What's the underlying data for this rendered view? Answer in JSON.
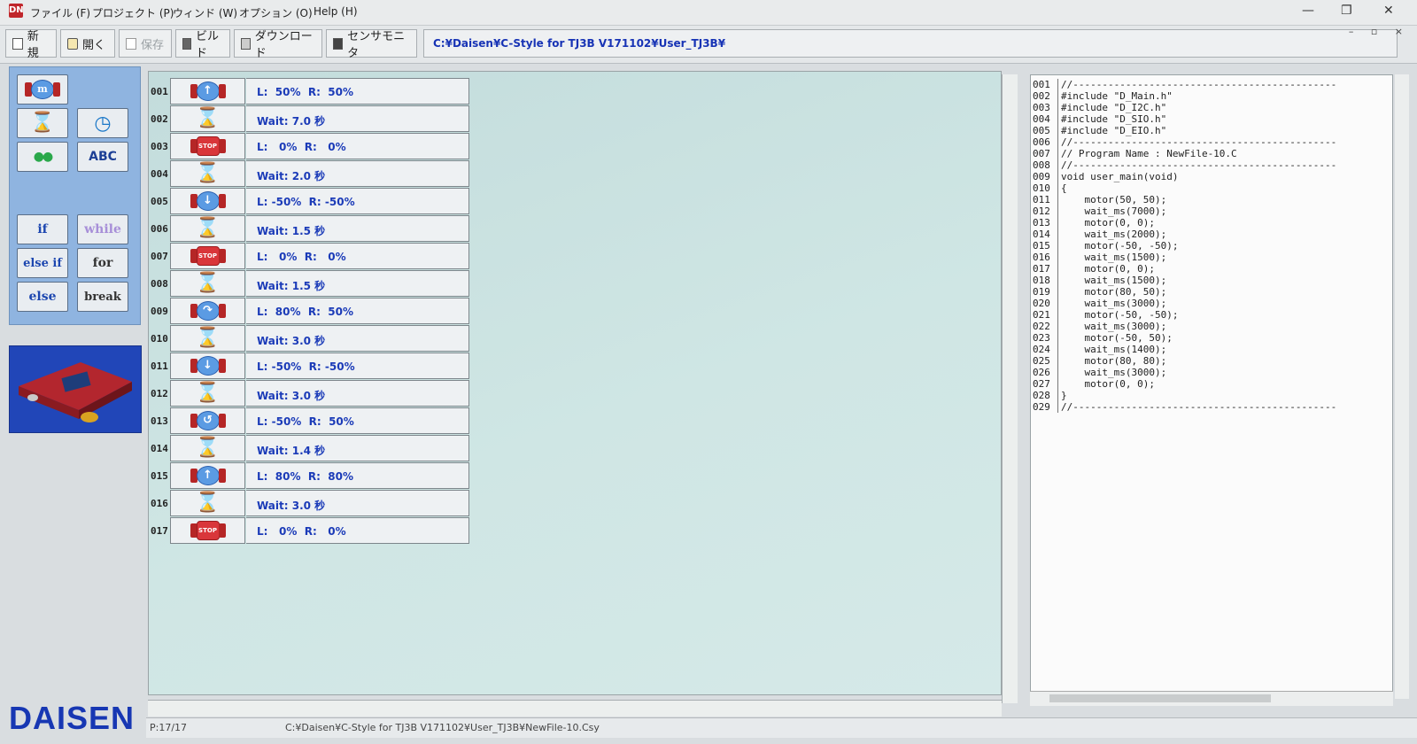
{
  "window": {
    "app_icon": "DN",
    "menus": [
      "ファイル (F)",
      "プロジェクト (P)",
      "ウィンド (W)",
      "オプション (O)",
      "Help (H)"
    ],
    "controls": [
      "—",
      "❐",
      "✕"
    ]
  },
  "toolbar": {
    "new_label": "新規",
    "open_label": "開く",
    "save_label": "保存",
    "build_label": "ビルド",
    "download_label": "ダウンロード",
    "sensor_label": "センサモニタ",
    "project_path": "C:¥Daisen¥C-Style for TJ3B V171102¥User_TJ3B¥"
  },
  "palette": {
    "motor_glyph": "m",
    "wait_glyph": "⌛",
    "timer_glyph": "◷",
    "led_glyph": "●●",
    "abc_label": "ABC",
    "if_label": "if",
    "while_label": "while",
    "elseif_label": "else if",
    "for_label": "for",
    "else_label": "else",
    "break_label": "break"
  },
  "brand": {
    "logo_text": "DAISEN"
  },
  "program": {
    "rows": [
      {
        "num": "001",
        "type": "motor",
        "dir": "↑",
        "text": "L:  50%  R:  50%"
      },
      {
        "num": "002",
        "type": "wait",
        "text": "Wait: 7.0 秒"
      },
      {
        "num": "003",
        "type": "stop",
        "text": "L:   0%  R:   0%"
      },
      {
        "num": "004",
        "type": "wait",
        "text": "Wait: 2.0 秒"
      },
      {
        "num": "005",
        "type": "motor",
        "dir": "↓",
        "text": "L: -50%  R: -50%"
      },
      {
        "num": "006",
        "type": "wait",
        "text": "Wait: 1.5 秒"
      },
      {
        "num": "007",
        "type": "stop",
        "text": "L:   0%  R:   0%"
      },
      {
        "num": "008",
        "type": "wait",
        "text": "Wait: 1.5 秒"
      },
      {
        "num": "009",
        "type": "motor",
        "dir": "↷",
        "text": "L:  80%  R:  50%"
      },
      {
        "num": "010",
        "type": "wait",
        "text": "Wait: 3.0 秒"
      },
      {
        "num": "011",
        "type": "motor",
        "dir": "↓",
        "text": "L: -50%  R: -50%"
      },
      {
        "num": "012",
        "type": "wait",
        "text": "Wait: 3.0 秒"
      },
      {
        "num": "013",
        "type": "motor",
        "dir": "↺",
        "text": "L: -50%  R:  50%"
      },
      {
        "num": "014",
        "type": "wait",
        "text": "Wait: 1.4 秒"
      },
      {
        "num": "015",
        "type": "motor",
        "dir": "↑",
        "text": "L:  80%  R:  80%"
      },
      {
        "num": "016",
        "type": "wait",
        "text": "Wait: 3.0 秒"
      },
      {
        "num": "017",
        "type": "stop",
        "text": "L:   0%  R:   0%"
      }
    ],
    "stop_label": "STOP",
    "hourglass_glyph": "⌛"
  },
  "code": {
    "lines": [
      {
        "num": "001",
        "text": "//---------------------------------------------"
      },
      {
        "num": "002",
        "text": "#include \"D_Main.h\""
      },
      {
        "num": "003",
        "text": "#include \"D_I2C.h\""
      },
      {
        "num": "004",
        "text": "#include \"D_SIO.h\""
      },
      {
        "num": "005",
        "text": "#include \"D_EIO.h\""
      },
      {
        "num": "006",
        "text": "//---------------------------------------------"
      },
      {
        "num": "007",
        "text": "// Program Name : NewFile-10.C"
      },
      {
        "num": "008",
        "text": "//---------------------------------------------"
      },
      {
        "num": "009",
        "text": "void user_main(void)"
      },
      {
        "num": "010",
        "text": "{"
      },
      {
        "num": "011",
        "text": "    motor(50, 50);"
      },
      {
        "num": "012",
        "text": "    wait_ms(7000);"
      },
      {
        "num": "013",
        "text": "    motor(0, 0);"
      },
      {
        "num": "014",
        "text": "    wait_ms(2000);"
      },
      {
        "num": "015",
        "text": "    motor(-50, -50);"
      },
      {
        "num": "016",
        "text": "    wait_ms(1500);"
      },
      {
        "num": "017",
        "text": "    motor(0, 0);"
      },
      {
        "num": "018",
        "text": "    wait_ms(1500);"
      },
      {
        "num": "019",
        "text": "    motor(80, 50);"
      },
      {
        "num": "020",
        "text": "    wait_ms(3000);"
      },
      {
        "num": "021",
        "text": "    motor(-50, -50);"
      },
      {
        "num": "022",
        "text": "    wait_ms(3000);"
      },
      {
        "num": "023",
        "text": "    motor(-50, 50);"
      },
      {
        "num": "024",
        "text": "    wait_ms(1400);"
      },
      {
        "num": "025",
        "text": "    motor(80, 80);"
      },
      {
        "num": "026",
        "text": "    wait_ms(3000);"
      },
      {
        "num": "027",
        "text": "    motor(0, 0);"
      },
      {
        "num": "028",
        "text": "}"
      },
      {
        "num": "029",
        "text": "//---------------------------------------------"
      }
    ]
  },
  "status": {
    "page_count": "P:17/17",
    "file_path": "C:¥Daisen¥C-Style for TJ3B V171102¥User_TJ3B¥NewFile-10.Csy"
  }
}
